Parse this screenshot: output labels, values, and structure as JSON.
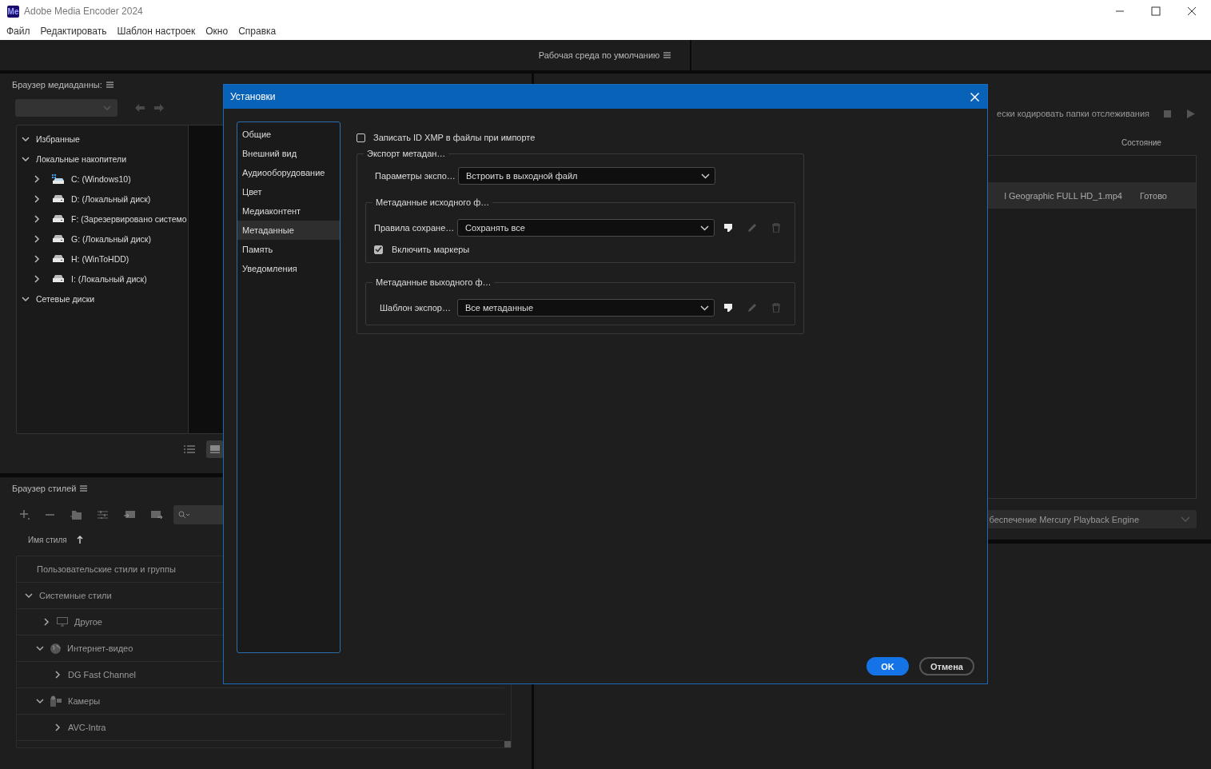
{
  "window": {
    "app_icon": "Me",
    "title": "Adobe Media Encoder 2024"
  },
  "menu": [
    "Файл",
    "Редактировать",
    "Шаблон настроек",
    "Окно",
    "Справка"
  ],
  "workspace": {
    "label": "Рабочая среда по умолчанию"
  },
  "media_browser": {
    "title": "Браузер медиаданны:",
    "tree": [
      {
        "label": "Избранные",
        "expanded": true
      },
      {
        "label": "Локальные накопители",
        "expanded": true,
        "children": [
          {
            "label": "C: (Windows10)",
            "kind": "system",
            "expanded": false
          },
          {
            "label": "D: (Локальный диск)",
            "kind": "disk",
            "expanded": false
          },
          {
            "label": "F: (Зарезервировано системо",
            "kind": "disk",
            "expanded": false
          },
          {
            "label": "G: (Локальный диск)",
            "kind": "disk",
            "expanded": false
          },
          {
            "label": "H: (WinToHDD)",
            "kind": "disk",
            "expanded": false
          },
          {
            "label": "I: (Локальный диск)",
            "kind": "disk",
            "expanded": false
          }
        ]
      },
      {
        "label": "Сетевые диски",
        "expanded": true
      }
    ]
  },
  "style_browser": {
    "title": "Браузер стилей",
    "column": "Имя стиля",
    "tree": [
      {
        "label": "Пользовательские стили и группы"
      },
      {
        "label": "Системные стили",
        "expanded": true,
        "children": [
          {
            "label": "Другое",
            "kind": "monitor",
            "expanded": false
          },
          {
            "label": "Интернет-видео",
            "kind": "globe",
            "expanded": true,
            "children": [
              {
                "label": "DG Fast Channel",
                "expanded": false
              }
            ]
          },
          {
            "label": "Камеры",
            "kind": "camera",
            "expanded": true,
            "children": [
              {
                "label": "AVC-Intra",
                "expanded": false
              }
            ]
          }
        ]
      }
    ]
  },
  "watch_folders": {
    "auto_encode_label": "ески кодировать папки отслеживания",
    "column": "Состояние",
    "rows": [
      {
        "name": "l Geographic FULL HD_1.mp4",
        "status": "Готово",
        "selected": true
      }
    ]
  },
  "renderer": {
    "value": "беспечение Mercury Playback Engine"
  },
  "dialog": {
    "title": "Установки",
    "nav": [
      {
        "label": "Общие",
        "selected": false
      },
      {
        "label": "Внешний вид",
        "selected": false
      },
      {
        "label": "Аудиооборудование",
        "selected": false
      },
      {
        "label": "Цвет",
        "selected": false
      },
      {
        "label": "Медиаконтент",
        "selected": false
      },
      {
        "label": "Метаданные",
        "selected": true
      },
      {
        "label": "Память",
        "selected": false
      },
      {
        "label": "Уведомления",
        "selected": false
      }
    ],
    "write_xmp": {
      "label": "Записать ID XMP в файлы при импорте",
      "checked": false
    },
    "export_group": {
      "title": "Экспорт метадан…",
      "param_label": "Параметры экспо…",
      "param_value": "Встроить в выходной файл"
    },
    "source_group": {
      "title": "Метаданные исходного ф…",
      "rule_label": "Правила сохране…",
      "rule_value": "Сохранять все",
      "markers": {
        "label": "Включить маркеры",
        "checked": true
      }
    },
    "output_group": {
      "title": "Метаданные выходного ф…",
      "template_label": "Шаблон экспор…",
      "template_value": "Все метаданные"
    },
    "buttons": [
      {
        "label": "OK",
        "kind": "primary"
      },
      {
        "label": "Отмена",
        "kind": "secondary"
      }
    ]
  }
}
